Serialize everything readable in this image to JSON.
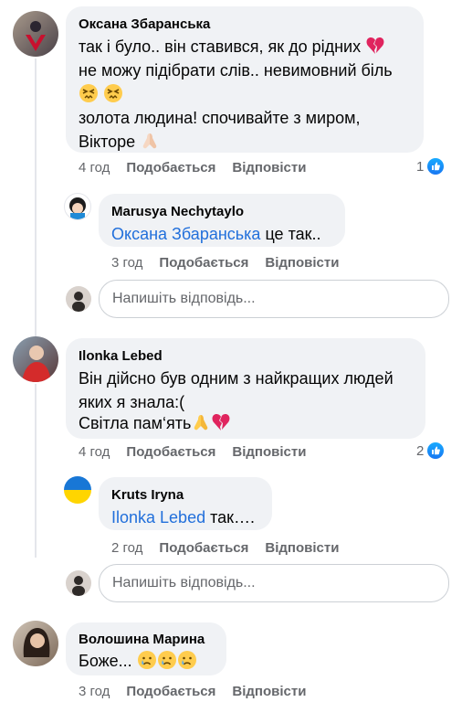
{
  "comments": [
    {
      "author": "Оксана Збаранська",
      "lines": [
        "так і було.. він ставився, як до рідних",
        "не можу підібрати слів.. невимовний біль",
        "",
        "золота людина! спочивайте з миром,",
        "Вікторе"
      ],
      "time": "4 год",
      "like_label": "Подобається",
      "reply_label": "Відповісти",
      "likes": "1"
    },
    {
      "author": "Marusya Nechytaylo",
      "mention": "Оксана Збаранська",
      "text": " це так..",
      "time": "3 год",
      "like_label": "Подобається",
      "reply_label": "Відповісти"
    },
    {
      "author": "Ilonka Lebed",
      "lines": [
        "Він дійсно був одним з найкращих людей",
        "яких я знала:(",
        "Світла пам‘ять"
      ],
      "time": "4 год",
      "like_label": "Подобається",
      "reply_label": "Відповісти",
      "likes": "2"
    },
    {
      "author": "Kruts Iryna",
      "mention": "Ilonka Lebed",
      "text": " так….",
      "time": "2 год",
      "like_label": "Подобається",
      "reply_label": "Відповісти"
    },
    {
      "author": "Волошина Марина",
      "text": "Боже...",
      "time": "3 год",
      "like_label": "Подобається",
      "reply_label": "Відповісти"
    }
  ],
  "reply_placeholder": "Напишіть відповідь...",
  "emojis": {
    "broken_heart": "broken-heart-icon",
    "sad": "persevering-face-icon",
    "pray": "folded-hands-icon",
    "cry": "crying-face-icon"
  },
  "colors": {
    "bubble": "#f0f2f5",
    "mention": "#216fdb",
    "meta": "#65676b",
    "like_badge": "#1877f2"
  }
}
